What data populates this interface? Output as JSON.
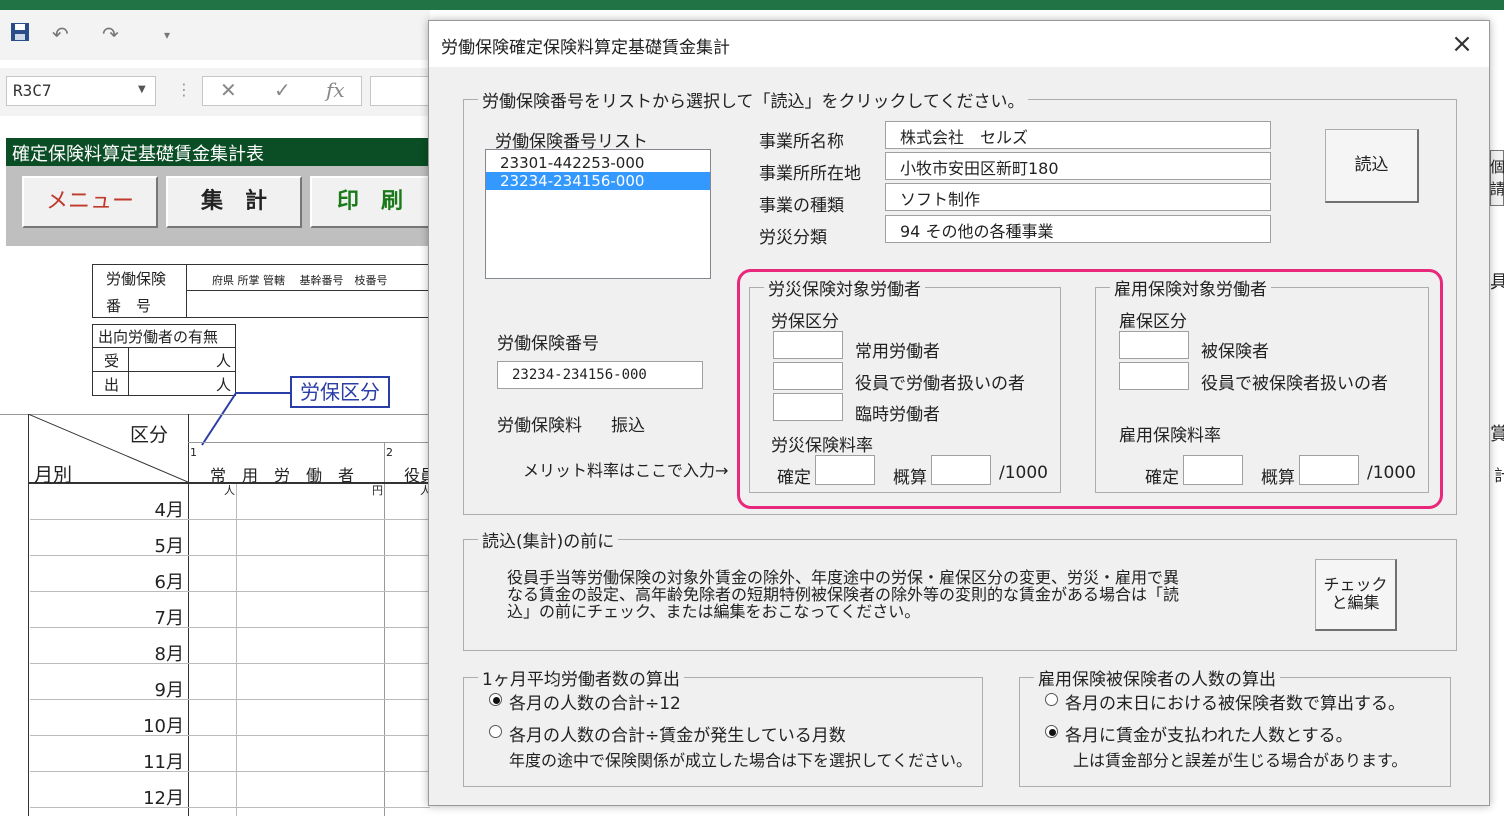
{
  "excel": {
    "name_box": "R3C7",
    "fx": "fx",
    "sheet_title": "確定保険料算定基礎賃金集計表",
    "buttons": {
      "menu": "メニュー",
      "total": "集　計",
      "print": "印　刷"
    },
    "header_box": {
      "label1": "労働保険",
      "label2": "番　号",
      "cols": "府県 所掌 管轄　 基幹番号　枝番号"
    },
    "dispatch": {
      "title": "出向労働者の有無",
      "in": "受",
      "out": "出",
      "unit": "人"
    },
    "callout": "労保区分",
    "grid": {
      "kubun": "区分",
      "monthly": "月別",
      "col1_num": "1",
      "col1": "常　用　労　働　者",
      "col2_num": "2",
      "col2": "役員",
      "unit_person": "人",
      "unit_yen": "円"
    },
    "months": [
      "4月",
      "5月",
      "6月",
      "7月",
      "8月",
      "9月",
      "10月",
      "11月",
      "12月"
    ],
    "right_edge": {
      "a": "個人",
      "b": "請幹",
      "c": "具",
      "d": "賞",
      "e": "計"
    }
  },
  "dialog": {
    "title": "労働保険確定保険料算定基礎賃金集計",
    "close": "×",
    "group1_legend": "労働保険番号をリストから選択して「読込」をクリックしてください。",
    "list_label": "労働保険番号リスト",
    "list_items": [
      "23301-442253-000",
      "23234-234156-000"
    ],
    "selected_index": 1,
    "fields": {
      "office_name_label": "事業所名称",
      "office_name": "株式会社　セルズ",
      "office_addr_label": "事業所所在地",
      "office_addr": "小牧市安田区新町180",
      "biz_type_label": "事業の種類",
      "biz_type": "ソフト制作",
      "accident_label": "労災分類",
      "accident": "94 その他の各種事業"
    },
    "load_button": "読込",
    "insurance_no_label": "労働保険番号",
    "insurance_no": "23234-234156-000",
    "premium_label": "労働保険料",
    "premium_value": "振込",
    "merit_label": "メリット料率はここで入力→",
    "rousai": {
      "legend": "労災保険対象労働者",
      "kubun_label": "労保区分",
      "items": [
        "常用労働者",
        "役員で労働者扱いの者",
        "臨時労働者"
      ],
      "rate_label": "労災保険料率",
      "confirm_label": "確定",
      "estimate_label": "概算",
      "per": "/1000"
    },
    "koyou": {
      "legend": "雇用保険対象労働者",
      "kubun_label": "雇保区分",
      "items": [
        "被保険者",
        "役員で被保険者扱いの者"
      ],
      "rate_label": "雇用保険料率",
      "confirm_label": "確定",
      "estimate_label": "概算",
      "per": "/1000"
    },
    "before": {
      "legend": "読込(集計)の前に",
      "line1": "役員手当等労働保険の対象外賃金の除外、年度途中の労保・雇保区分の変更、労災・雇用で異",
      "line2": "なる賃金の設定、高年齢免除者の短期特例被保険者の除外等の変則的な賃金がある場合は「読",
      "line3": "込」の前にチェック、または編集をおこなってください。",
      "button_line1": "チェック",
      "button_line2": "と編集"
    },
    "avg": {
      "legend": "1ヶ月平均労働者数の算出",
      "opt1": "各月の人数の合計÷12",
      "opt2": "各月の人数の合計÷賃金が発生している月数",
      "note": "年度の途中で保険関係が成立した場合は下を選択してください。",
      "selected": 0
    },
    "insured": {
      "legend": "雇用保険被保険者の人数の算出",
      "opt1": "各月の末日における被保険者数で算出する。",
      "opt2": "各月に賃金が支払われた人数とする。",
      "note": "上は賃金部分と誤差が生じる場合があります。",
      "selected": 1
    }
  }
}
